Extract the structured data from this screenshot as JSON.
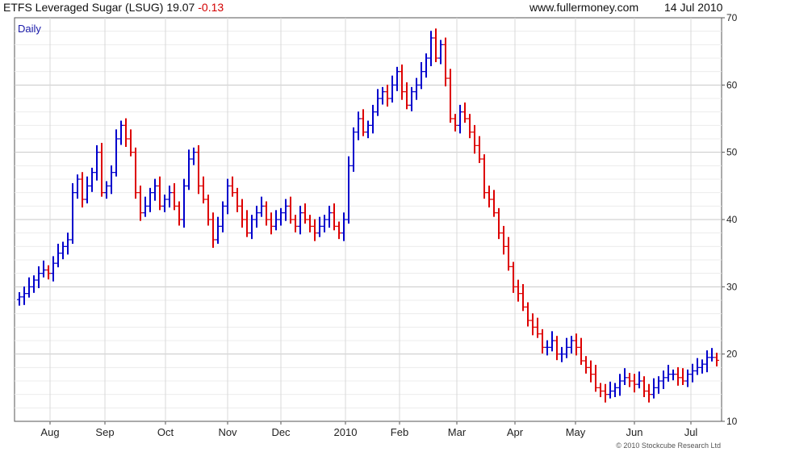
{
  "header": {
    "title": "ETFS Leveraged Sugar (LSUG)",
    "last": "19.07",
    "change": "-0.13",
    "site": "www.fullermoney.com",
    "date": "14 Jul 2010"
  },
  "footer": {
    "copyright": "© 2010 Stockcube Research Ltd"
  },
  "chart_data": {
    "type": "ohlc",
    "period_label": "Daily",
    "y_range": [
      10,
      70
    ],
    "y_ticks": [
      10,
      20,
      30,
      40,
      50,
      60,
      70
    ],
    "x_ticks": [
      "Aug",
      "Sep",
      "Oct",
      "Nov",
      "Dec",
      "2010",
      "Feb",
      "Mar",
      "Apr",
      "May",
      "Jun",
      "Jul"
    ],
    "up_color": "#0000cc",
    "down_color": "#dd0000",
    "series": [
      {
        "values": [
          28.5,
          29.0,
          30.0,
          31.0,
          32.0,
          32.5,
          32.0,
          33.5,
          35.0,
          36.0,
          37.0,
          44.0,
          46.0,
          43.0,
          45.0,
          47.0,
          50.0,
          44.0,
          45.0,
          47.0,
          52.0,
          54.0,
          52.0,
          50.0,
          44.0,
          41.0,
          42.0,
          44.0,
          45.0,
          42.0,
          43.0,
          44.0,
          42.0,
          40.0,
          45.0,
          49.0,
          50.0,
          45.0,
          43.0,
          40.0,
          37.0,
          39.0,
          42.0,
          45.0,
          44.0,
          42.0,
          40.0,
          38.0,
          40.0,
          41.0,
          42.0,
          40.0,
          39.0,
          40.0,
          41.0,
          42.0,
          40.0,
          39.0,
          41.0,
          40.0,
          39.0,
          38.0,
          39.0,
          40.0,
          41.0,
          39.0,
          38.0,
          40.0,
          48.0,
          53.0,
          55.0,
          53.0,
          54.0,
          56.0,
          58.0,
          59.0,
          58.0,
          60.0,
          62.0,
          59.0,
          57.0,
          59.0,
          60.0,
          62.0,
          64.0,
          67.0,
          64.0,
          66.0,
          61.0,
          55.0,
          54.0,
          56.0,
          55.0,
          53.0,
          51.0,
          49.0,
          44.0,
          43.0,
          41.0,
          38.0,
          36.0,
          33.0,
          30.0,
          29.0,
          27.0,
          25.0,
          24.0,
          23.0,
          21.0,
          21.0,
          22.0,
          20.0,
          20.0,
          21.0,
          22.0,
          21.0,
          19.0,
          18.0,
          17.0,
          15.0,
          14.5,
          14.0,
          14.5,
          15.0,
          16.0,
          16.5,
          16.0,
          15.5,
          16.0,
          14.5,
          14.0,
          15.0,
          16.0,
          16.5,
          17.0,
          17.0,
          16.5,
          16.0,
          17.0,
          17.5,
          18.0,
          18.5,
          19.5,
          19.5,
          19.07
        ]
      }
    ]
  }
}
